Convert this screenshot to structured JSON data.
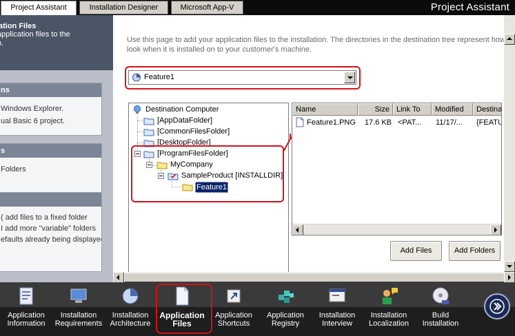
{
  "tabs": [
    {
      "label": "Project Assistant",
      "active": true
    },
    {
      "label": "Installation Designer",
      "active": false
    },
    {
      "label": "Microsoft App-V",
      "active": false
    }
  ],
  "app_title": "Project Assistant",
  "left_panel": {
    "header_title": "ation Files",
    "header_desc_1": "application files to the",
    "header_desc_2": "n.",
    "box1": {
      "head": "ns",
      "lines": [
        "Windows Explorer.",
        "ual Basic 6 project."
      ]
    },
    "box2": {
      "head": "s",
      "lines": [
        "Folders"
      ]
    },
    "box3": {
      "head": "",
      "lines": [
        "( add files to a fixed folder",
        "",
        "I add more \"variable\" folders",
        "efaults already being displayed"
      ]
    }
  },
  "intro": {
    "line1": "Use this page to add your application files to the installation. The directories in the destination tree represent how your",
    "line2": "look when it is installed on to your customer's machine."
  },
  "feature_combo": {
    "value": "Feature1"
  },
  "tree": {
    "root": "Destination Computer",
    "nodes": [
      {
        "label": "[AppDataFolder]"
      },
      {
        "label": "[CommonFilesFolder]"
      },
      {
        "label": "[DesktopFolder]"
      },
      {
        "label": "[ProgramFilesFolder]"
      },
      {
        "label": "MyCompany"
      },
      {
        "label": "SampleProduct [INSTALLDIR]"
      },
      {
        "label": "Feature1"
      }
    ]
  },
  "file_list": {
    "columns": [
      "Name",
      "Size",
      "Link To",
      "Modified",
      "Destina"
    ],
    "rows": [
      {
        "name": "Feature1.PNG",
        "size": "17.6 KB",
        "link_to": "<PAT...",
        "modified": "11/17/...",
        "destination": "{FEATU"
      }
    ]
  },
  "buttons": {
    "add_files": "Add Files",
    "add_folders": "Add Folders"
  },
  "nav": [
    {
      "l1": "Application",
      "l2": "Information",
      "icon": "application-information-icon"
    },
    {
      "l1": "Installation",
      "l2": "Requirements",
      "icon": "installation-requirements-icon"
    },
    {
      "l1": "Installation",
      "l2": "Architecture",
      "icon": "installation-architecture-icon"
    },
    {
      "l1": "Application",
      "l2": "Files",
      "icon": "application-files-icon",
      "active": true
    },
    {
      "l1": "Application",
      "l2": "Shortcuts",
      "icon": "application-shortcuts-icon"
    },
    {
      "l1": "Application",
      "l2": "Registry",
      "icon": "application-registry-icon"
    },
    {
      "l1": "Installation",
      "l2": "Interview",
      "icon": "installation-interview-icon"
    },
    {
      "l1": "Installation",
      "l2": "Localization",
      "icon": "installation-localization-icon"
    },
    {
      "l1": "Build",
      "l2": "Installation",
      "icon": "build-installation-icon"
    }
  ],
  "colors": {
    "highlight_red": "#d4101a",
    "selection_blue": "#0a246a",
    "nav_bg": "#1e1e1e"
  }
}
